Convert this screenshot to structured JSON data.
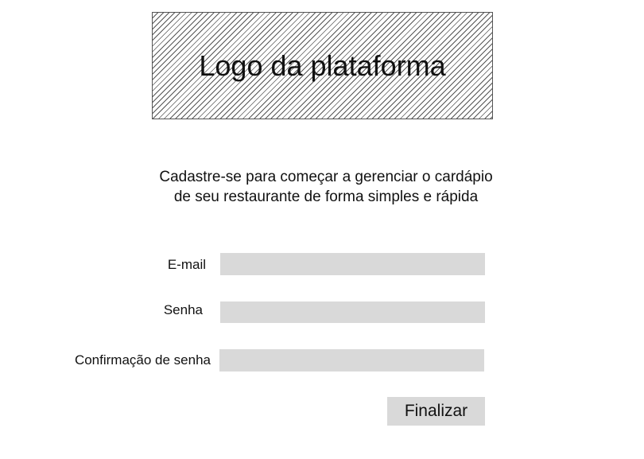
{
  "logo": {
    "text": "Logo da plataforma"
  },
  "tagline": {
    "line1": "Cadastre-se para começar a gerenciar o cardápio",
    "line2": "de seu restaurante de forma simples e rápida"
  },
  "form": {
    "email": {
      "label": "E-mail",
      "value": "",
      "placeholder": ""
    },
    "password": {
      "label": "Senha",
      "value": "",
      "placeholder": ""
    },
    "password_confirm": {
      "label": "Confirmação de senha",
      "value": "",
      "placeholder": ""
    },
    "submit_label": "Finalizar"
  },
  "colors": {
    "input_background": "#d9d9d9",
    "button_background": "#d9d9d9",
    "text": "#111111",
    "logo_hatch": "#555555"
  }
}
